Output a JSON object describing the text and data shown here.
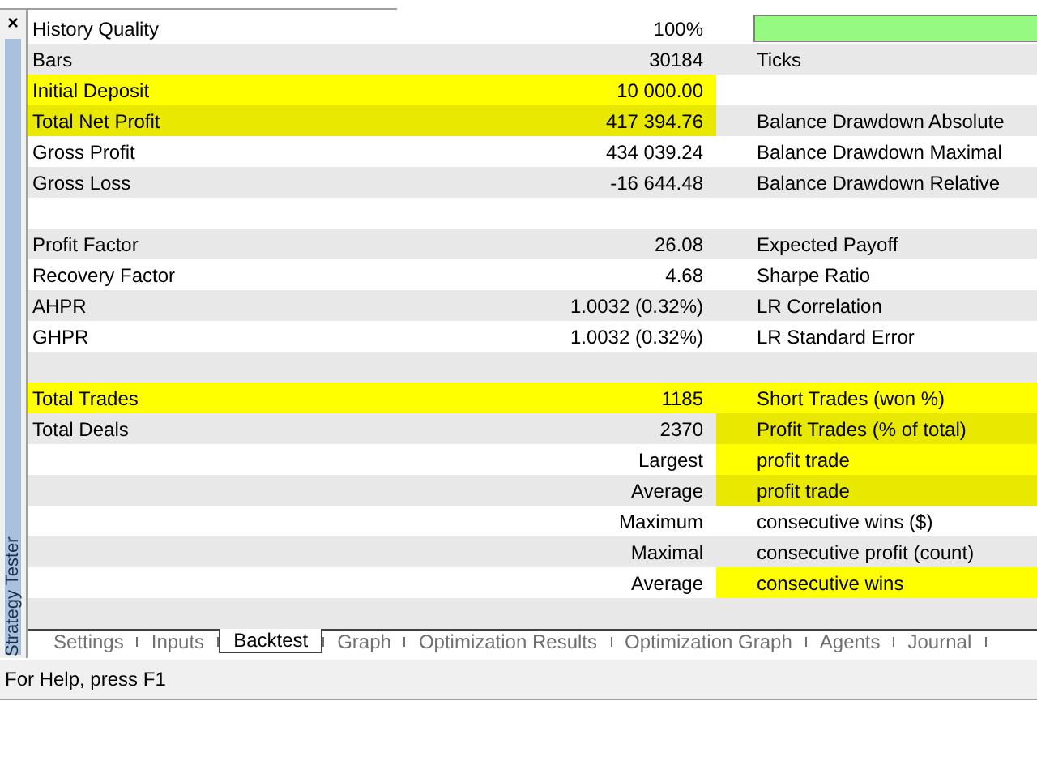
{
  "panel": {
    "close": "×",
    "title": "Strategy Tester"
  },
  "rows": [
    {
      "label": "History Quality",
      "value": "100%",
      "col3": "",
      "bar": {
        "level": 1
      },
      "mark_left": false,
      "mark_right": false
    },
    {
      "label": "Bars",
      "value": "30184",
      "col3": "Ticks",
      "mark_left": false,
      "mark_right": false
    },
    {
      "label": "Initial Deposit",
      "value": "10 000.00",
      "col3": "",
      "mark_left": true,
      "mark_right": false
    },
    {
      "label": "Total Net Profit",
      "value": "417 394.76",
      "col3": "Balance Drawdown Absolute",
      "mark_left": true,
      "mark_right": false
    },
    {
      "label": "Gross Profit",
      "value": "434 039.24",
      "col3": "Balance Drawdown Maximal",
      "mark_left": false,
      "mark_right": false
    },
    {
      "label": "Gross Loss",
      "value": "-16 644.48",
      "col3": "Balance Drawdown Relative",
      "mark_left": false,
      "mark_right": false
    },
    {
      "label": "",
      "value": "",
      "col3": "",
      "mark_left": false,
      "mark_right": false
    },
    {
      "label": "Profit Factor",
      "value": "26.08",
      "col3": "Expected Payoff",
      "mark_left": false,
      "mark_right": false
    },
    {
      "label": "Recovery Factor",
      "value": "4.68",
      "col3": "Sharpe Ratio",
      "mark_left": false,
      "mark_right": false
    },
    {
      "label": "AHPR",
      "value": "1.0032 (0.32%)",
      "col3": "LR Correlation",
      "mark_left": false,
      "mark_right": false
    },
    {
      "label": "GHPR",
      "value": "1.0032 (0.32%)",
      "col3": "LR Standard Error",
      "mark_left": false,
      "mark_right": false
    },
    {
      "label": "",
      "value": "",
      "col3": "",
      "mark_left": false,
      "mark_right": false
    },
    {
      "label": "Total Trades",
      "value": "1185",
      "col3": "Short Trades (won %)",
      "mark_left": true,
      "mark_right": true
    },
    {
      "label": "Total Deals",
      "value": "2370",
      "col3": "Profit Trades (% of total)",
      "mark_left": false,
      "mark_right": true
    },
    {
      "label": "",
      "value": "Largest",
      "col3": "profit trade",
      "mark_left": false,
      "mark_right": true
    },
    {
      "label": "",
      "value": "Average",
      "col3": "profit trade",
      "mark_left": false,
      "mark_right": true
    },
    {
      "label": "",
      "value": "Maximum",
      "col3": "consecutive wins ($)",
      "mark_left": false,
      "mark_right": false
    },
    {
      "label": "",
      "value": "Maximal",
      "col3": "consecutive profit (count)",
      "mark_left": false,
      "mark_right": false
    },
    {
      "label": "",
      "value": "Average",
      "col3": "consecutive wins",
      "mark_left": false,
      "mark_right": true
    },
    {
      "label": "",
      "value": "",
      "col3": "",
      "mark_left": false,
      "mark_right": false
    }
  ],
  "tabs": [
    {
      "label": "Settings",
      "selected": false
    },
    {
      "label": "Inputs",
      "selected": false
    },
    {
      "label": "Backtest",
      "selected": true
    },
    {
      "label": "Graph",
      "selected": false
    },
    {
      "label": "Optimization Results",
      "selected": false
    },
    {
      "label": "Optimization Graph",
      "selected": false
    },
    {
      "label": "Agents",
      "selected": false
    },
    {
      "label": "Journal",
      "selected": false
    }
  ],
  "status_bar": "For Help, press F1"
}
